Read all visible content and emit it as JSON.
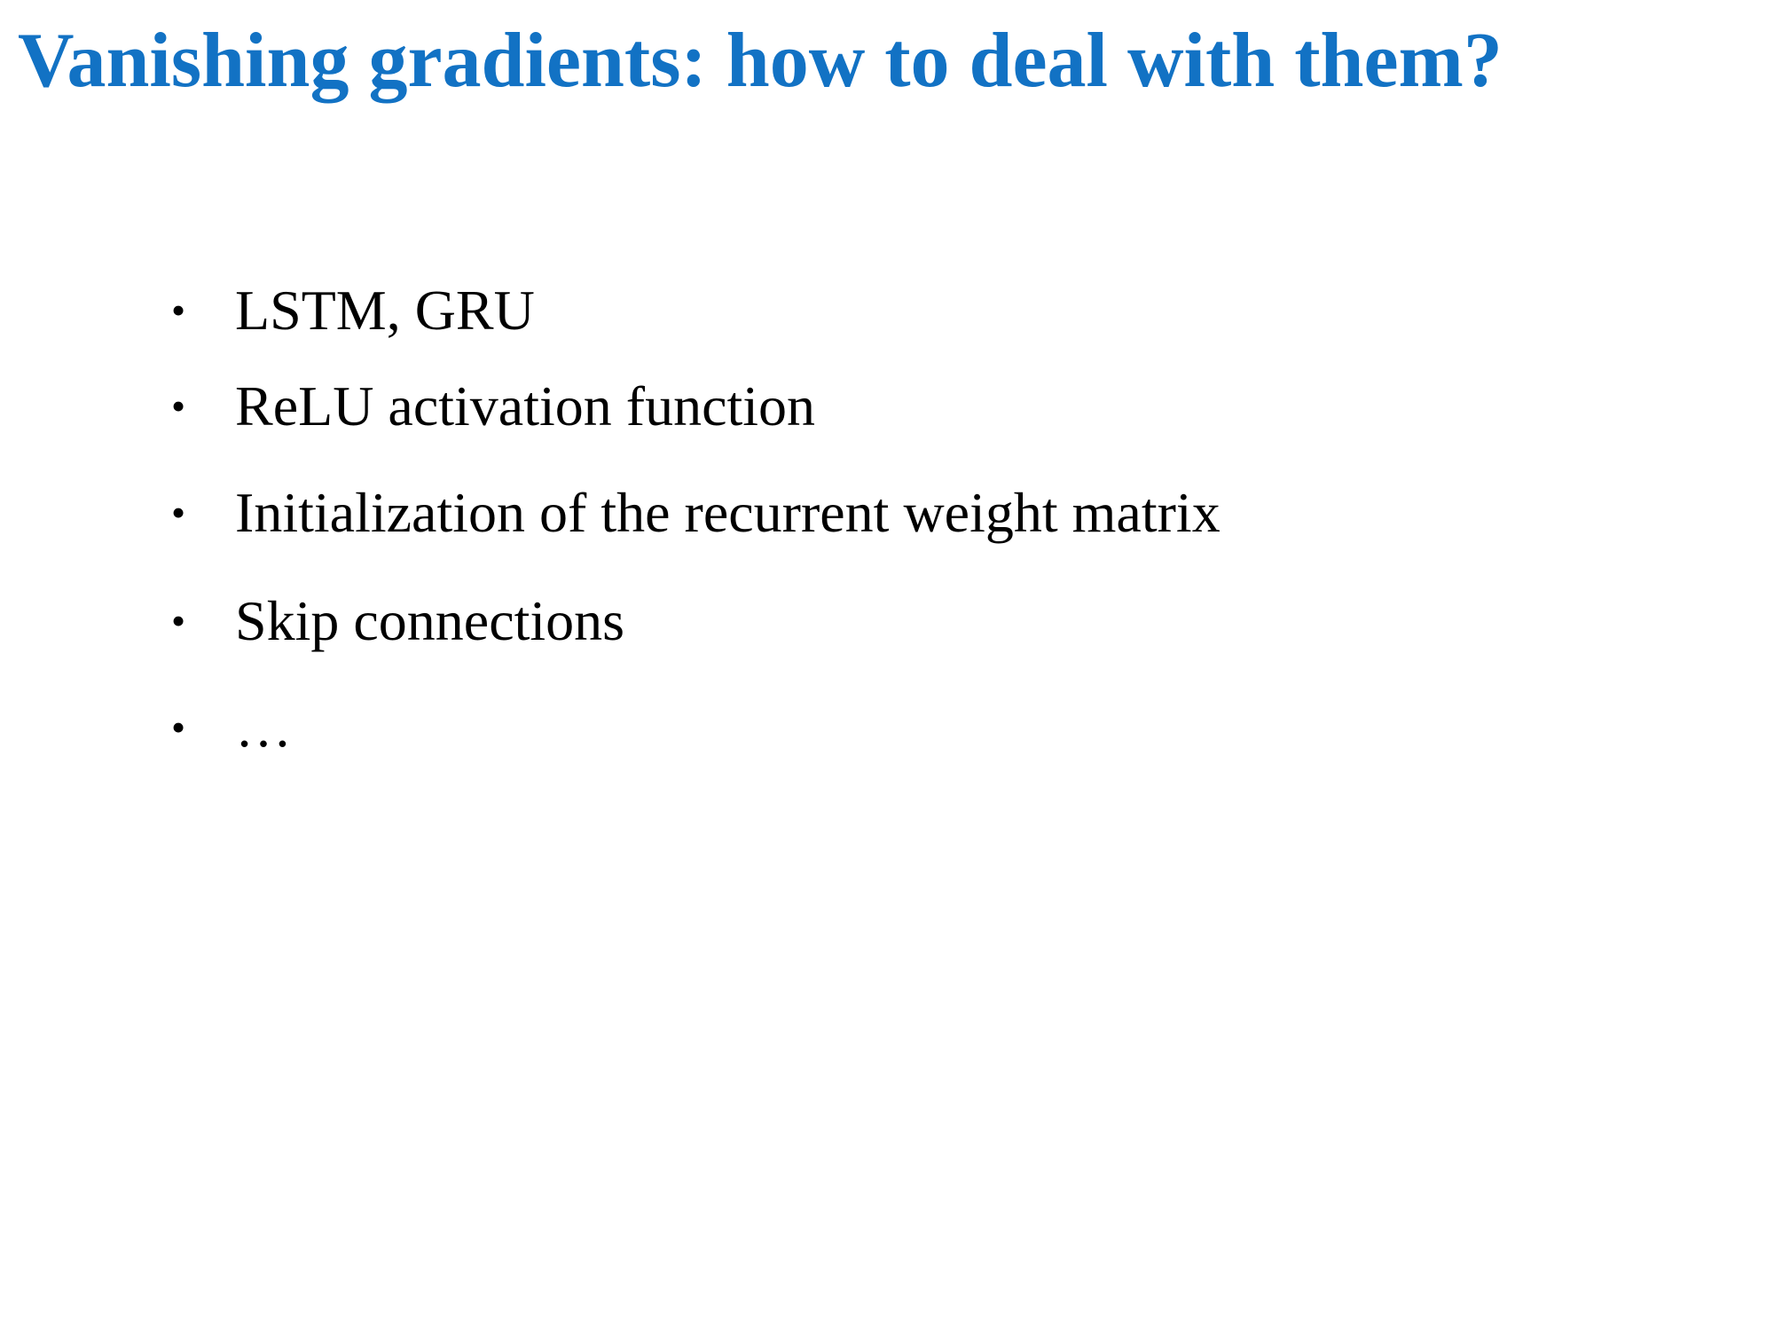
{
  "slide": {
    "title": "Vanishing gradients: how to deal with them?",
    "title_color": "#1272c4",
    "bullet_symbol": "•",
    "bullets": [
      "LSTM, GRU",
      "ReLU activation function",
      "Initialization of the recurrent weight matrix",
      "Skip connections",
      "…"
    ]
  }
}
